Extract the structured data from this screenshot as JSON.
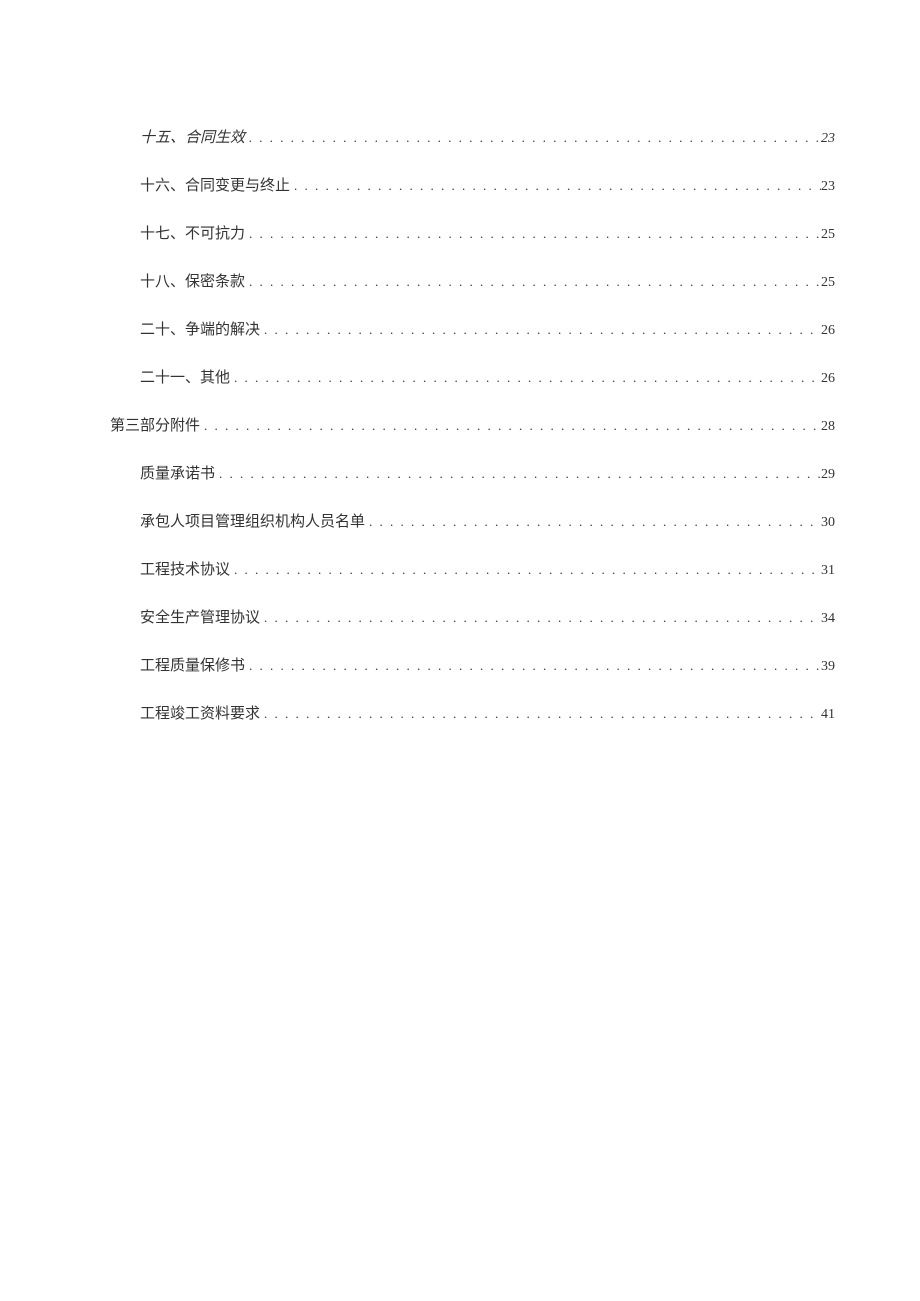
{
  "toc": {
    "entries": [
      {
        "level": 2,
        "title": "十五、合同生效",
        "page": "23",
        "italic": true
      },
      {
        "level": 2,
        "title": "十六、合同变更与终止",
        "page": "23",
        "italic": false
      },
      {
        "level": 2,
        "title": "十七、不可抗力",
        "page": "25",
        "italic": false
      },
      {
        "level": 2,
        "title": "十八、保密条款",
        "page": "25",
        "italic": false
      },
      {
        "level": 2,
        "title": "二十、争端的解决",
        "page": "26",
        "italic": false
      },
      {
        "level": 2,
        "title": "二十一、其他",
        "page": "26",
        "italic": false
      },
      {
        "level": 1,
        "title": "第三部分附件",
        "page": "28",
        "italic": false
      },
      {
        "level": 2,
        "title": "质量承诺书",
        "page": "29",
        "italic": false
      },
      {
        "level": 2,
        "title": "承包人项目管理组织机构人员名单",
        "page": "30",
        "italic": false
      },
      {
        "level": 2,
        "title": "工程技术协议",
        "page": "31",
        "italic": false
      },
      {
        "level": 2,
        "title": "安全生产管理协议",
        "page": "34",
        "italic": false
      },
      {
        "level": 2,
        "title": "工程质量保修书",
        "page": "39",
        "italic": false
      },
      {
        "level": 2,
        "title": "工程竣工资料要求",
        "page": "41",
        "italic": false
      }
    ]
  }
}
